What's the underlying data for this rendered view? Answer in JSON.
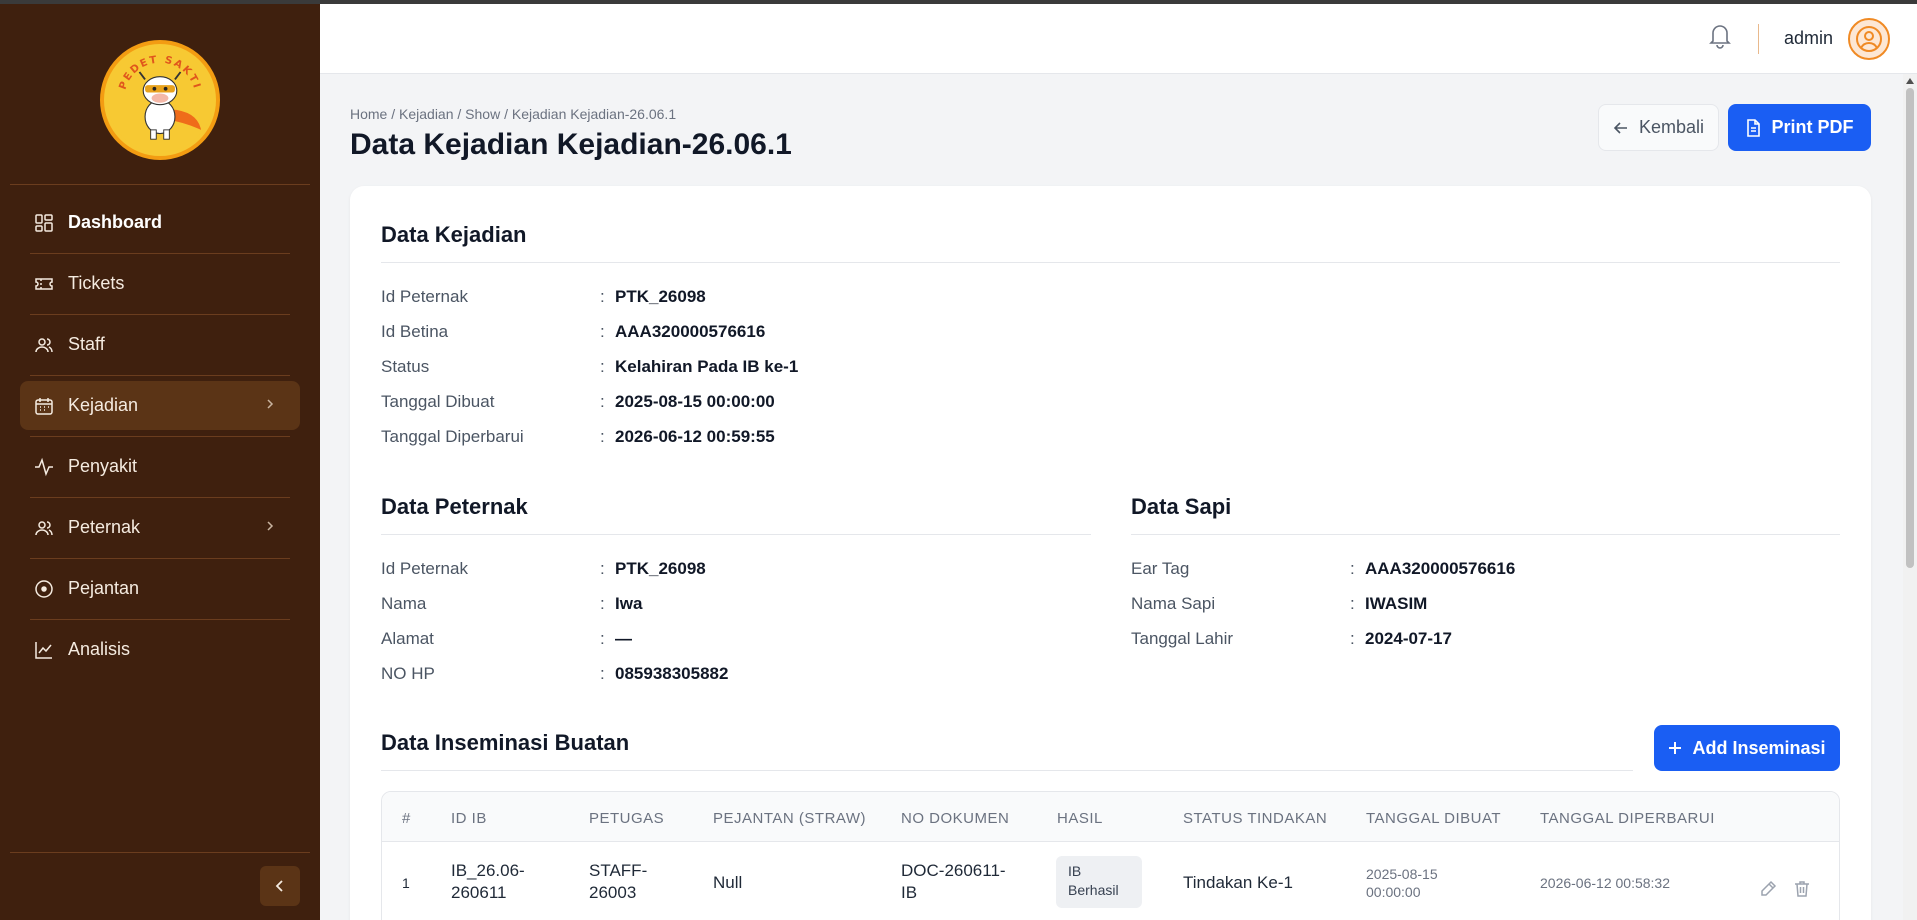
{
  "sidebar": {
    "logo_text": "PEDET SAKTI",
    "items": [
      {
        "label": "Dashboard",
        "icon": "dashboard-icon"
      },
      {
        "label": "Tickets",
        "icon": "ticket-icon"
      },
      {
        "label": "Staff",
        "icon": "users-icon"
      },
      {
        "label": "Kejadian",
        "icon": "calendar-icon"
      },
      {
        "label": "Penyakit",
        "icon": "activity-icon"
      },
      {
        "label": "Peternak",
        "icon": "users-icon"
      },
      {
        "label": "Pejantan",
        "icon": "circle-dot-icon"
      },
      {
        "label": "Analisis",
        "icon": "line-chart-icon"
      }
    ]
  },
  "header": {
    "user": "admin"
  },
  "page": {
    "breadcrumb": "Home / Kejadian / Show / Kejadian Kejadian-26.06.1",
    "title": "Data Kejadian Kejadian-26.06.1",
    "back_label": "Kembali",
    "print_label": "Print PDF"
  },
  "kejadian": {
    "title": "Data Kejadian",
    "rows": [
      {
        "label": "Id Peternak",
        "value": "PTK_26098"
      },
      {
        "label": "Id Betina",
        "value": "AAA320000576616"
      },
      {
        "label": "Status",
        "value": "Kelahiran Pada IB ke-1"
      },
      {
        "label": "Tanggal Dibuat",
        "value": "2025-08-15 00:00:00"
      },
      {
        "label": "Tanggal Diperbarui",
        "value": "2026-06-12 00:59:55"
      }
    ]
  },
  "peternak": {
    "title": "Data Peternak",
    "rows": [
      {
        "label": "Id Peternak",
        "value": "PTK_26098"
      },
      {
        "label": "Nama",
        "value": "Iwa"
      },
      {
        "label": "Alamat",
        "value": "—"
      },
      {
        "label": "NO HP",
        "value": "085938305882"
      }
    ]
  },
  "sapi": {
    "title": "Data Sapi",
    "rows": [
      {
        "label": "Ear Tag",
        "value": "AAA320000576616"
      },
      {
        "label": "Nama Sapi",
        "value": "IWASIM"
      },
      {
        "label": "Tanggal Lahir",
        "value": "2024-07-17"
      }
    ]
  },
  "inseminasi": {
    "title": "Data Inseminasi Buatan",
    "add_label": "Add Inseminasi",
    "columns": [
      "#",
      "ID IB",
      "PETUGAS",
      "PEJANTAN (STRAW)",
      "NO DOKUMEN",
      "HASIL",
      "STATUS TINDAKAN",
      "TANGGAL DIBUAT",
      "TANGGAL DIPERBARUI"
    ],
    "rows": [
      {
        "no": "1",
        "id_ib_1": "IB_26.06-",
        "id_ib_2": "260611",
        "petugas_1": "STAFF-",
        "petugas_2": "26003",
        "pejantan": "Null",
        "dok_1": "DOC-260611-",
        "dok_2": "IB",
        "hasil_1": "IB",
        "hasil_2": "Berhasil",
        "status": "Tindakan Ke-1",
        "dibuat_1": "2025-08-15",
        "dibuat_2": "00:00:00",
        "diperbarui": "2026-06-12 00:58:32"
      }
    ]
  },
  "colors": {
    "sidebar_bg": "#3f200e",
    "primary": "#1a5ef3",
    "avatar_accent": "#f08a24"
  }
}
